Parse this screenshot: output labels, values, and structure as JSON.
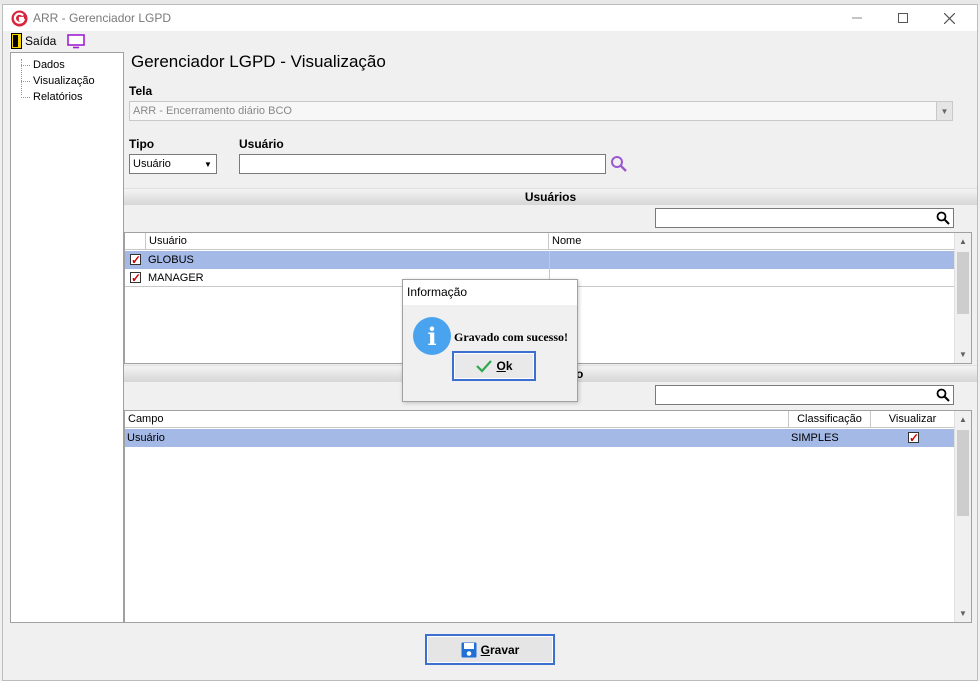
{
  "window": {
    "title": "ARR - Gerenciador LGPD"
  },
  "menu": {
    "exit_label": "Saída"
  },
  "tree": {
    "items": [
      "Dados",
      "Visualização",
      "Relatórios"
    ]
  },
  "main": {
    "title": "Gerenciador LGPD - Visualização",
    "tela_label": "Tela",
    "tela_value": "ARR -  Encerramento diário BCO",
    "tipo_label": "Tipo",
    "tipo_value": "Usuário",
    "usuario_label": "Usuário",
    "usuario_value": ""
  },
  "users_section": {
    "title": "Usuários",
    "columns": [
      "Usuário",
      "Nome"
    ],
    "rows": [
      {
        "user": "GLOBUS",
        "name": "",
        "checked": true,
        "selected": true
      },
      {
        "user": "MANAGER",
        "name": "",
        "checked": true,
        "selected": false
      }
    ]
  },
  "fields_section": {
    "title_tail": "o",
    "columns": [
      "Campo",
      "Classificação",
      "Visualizar"
    ],
    "rows": [
      {
        "campo": "Usuário",
        "classificacao": "SIMPLES",
        "visualizar": true
      }
    ]
  },
  "dialog": {
    "title": "Informação",
    "message": "Gravado com sucesso!",
    "ok_accel": "O",
    "ok_rest": "k"
  },
  "footer": {
    "save_accel": "G",
    "save_rest": "ravar"
  },
  "colors": {
    "selection": "#a4b9e6",
    "info_icon": "#4aa3ee",
    "focus_border": "#3d6fd0",
    "search_icon": "#9b59d0"
  }
}
